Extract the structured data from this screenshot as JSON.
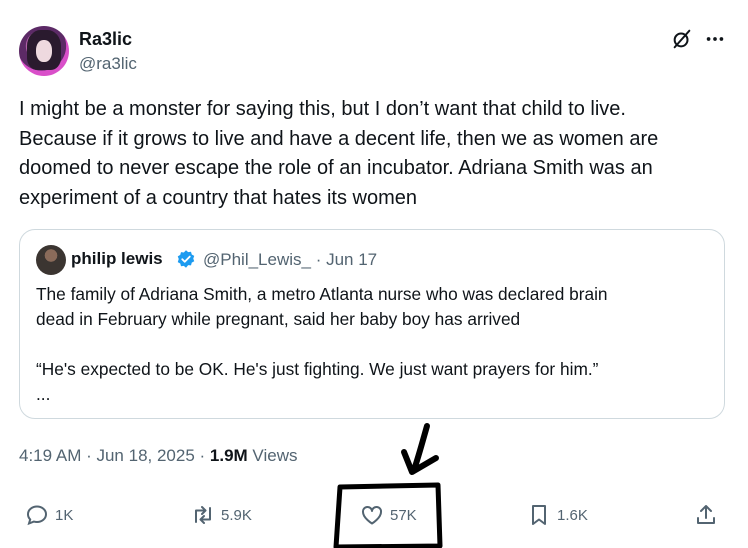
{
  "author": {
    "name": "Ra3lic",
    "handle": "@ra3lic"
  },
  "tweet": {
    "lines": [
      "I might be a monster for saying this, but I don’t want that child to live.",
      "Because if it grows to live and have a decent life, then we as women are",
      "doomed to never escape the role of an incubator. Adriana Smith was an",
      "experiment of a country that hates its women"
    ]
  },
  "quote": {
    "name": "philip lewis",
    "handle": "@Phil_Lewis_ · Jun 17",
    "line1": "The family of Adriana Smith, a metro Atlanta nurse who was declared brain",
    "line2": "dead in February while pregnant, said her baby boy has arrived",
    "line3": "“He's expected to be OK. He's just fighting. We just want prayers for him.”",
    "line4": "..."
  },
  "meta": {
    "time": "4:19 AM · Jun 18, 2025 · ",
    "views_count": "1.9M",
    "views_label": " Views"
  },
  "actions": {
    "replies": "1K",
    "reposts": "5.9K",
    "likes": "57K",
    "bookmarks": "1.6K"
  },
  "colors": {
    "text": "#0f1419",
    "secondary": "#536471",
    "verified": "#1d9bf0",
    "border": "#cfd9de"
  }
}
